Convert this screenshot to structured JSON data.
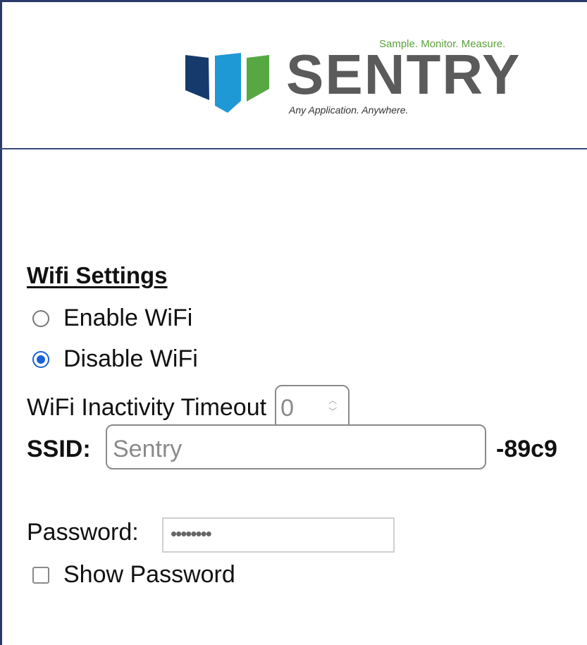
{
  "header": {
    "logo_tagline": "Sample. Monitor. Measure.",
    "logo_brand": "SENTRY",
    "logo_subtagline": "Any Application. Anywhere.",
    "logo_colors": {
      "navy": "#163a6b",
      "blue": "#1f98d6",
      "green": "#57a843"
    }
  },
  "wifi": {
    "section_title": "Wifi Settings",
    "options": [
      {
        "label": "Enable WiFi",
        "checked": false
      },
      {
        "label": "Disable WiFi",
        "checked": true
      }
    ],
    "timeout_label": "WiFi Inactivity Timeout",
    "timeout_value": "0",
    "ssid_label": "SSID:",
    "ssid_placeholder": "Sentry",
    "ssid_suffix": "-89c9",
    "password_label": "Password:",
    "password_value": "••••••••",
    "show_password_label": "Show Password",
    "show_password_checked": false,
    "accent_color": "#1a62d6"
  }
}
